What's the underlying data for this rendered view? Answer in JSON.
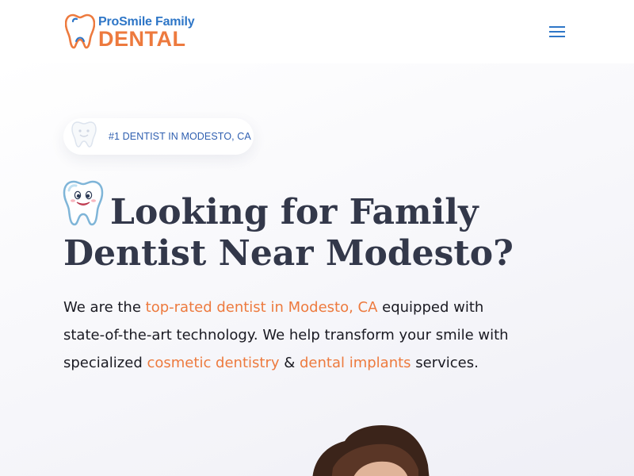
{
  "brand": {
    "name_line1": "ProSmile Family",
    "name_line2": "DENTAL",
    "primary_color": "#2e76c7",
    "accent_color": "#ed7a3e",
    "logo_icon": "tooth-icon"
  },
  "nav": {
    "menu_icon": "hamburger-menu-icon"
  },
  "hero": {
    "badge_icon": "tooth-icon",
    "badge_text": "#1 DENTIST IN MODESTO, CA",
    "title_icon": "smiling-tooth-icon",
    "title_line1": "Looking for Family",
    "title_line2": "Dentist Near Modesto?",
    "desc_intro": "We are the ",
    "desc_link1": "top-rated dentist in Modesto, CA",
    "desc_mid": " equipped with state-of-the-art technology. We help transform your smile with specialized ",
    "desc_link2": "cosmetic dentistry",
    "desc_amp": " & ",
    "desc_link3": "dental implants",
    "desc_end": " services.",
    "text_color": "#33384a"
  }
}
